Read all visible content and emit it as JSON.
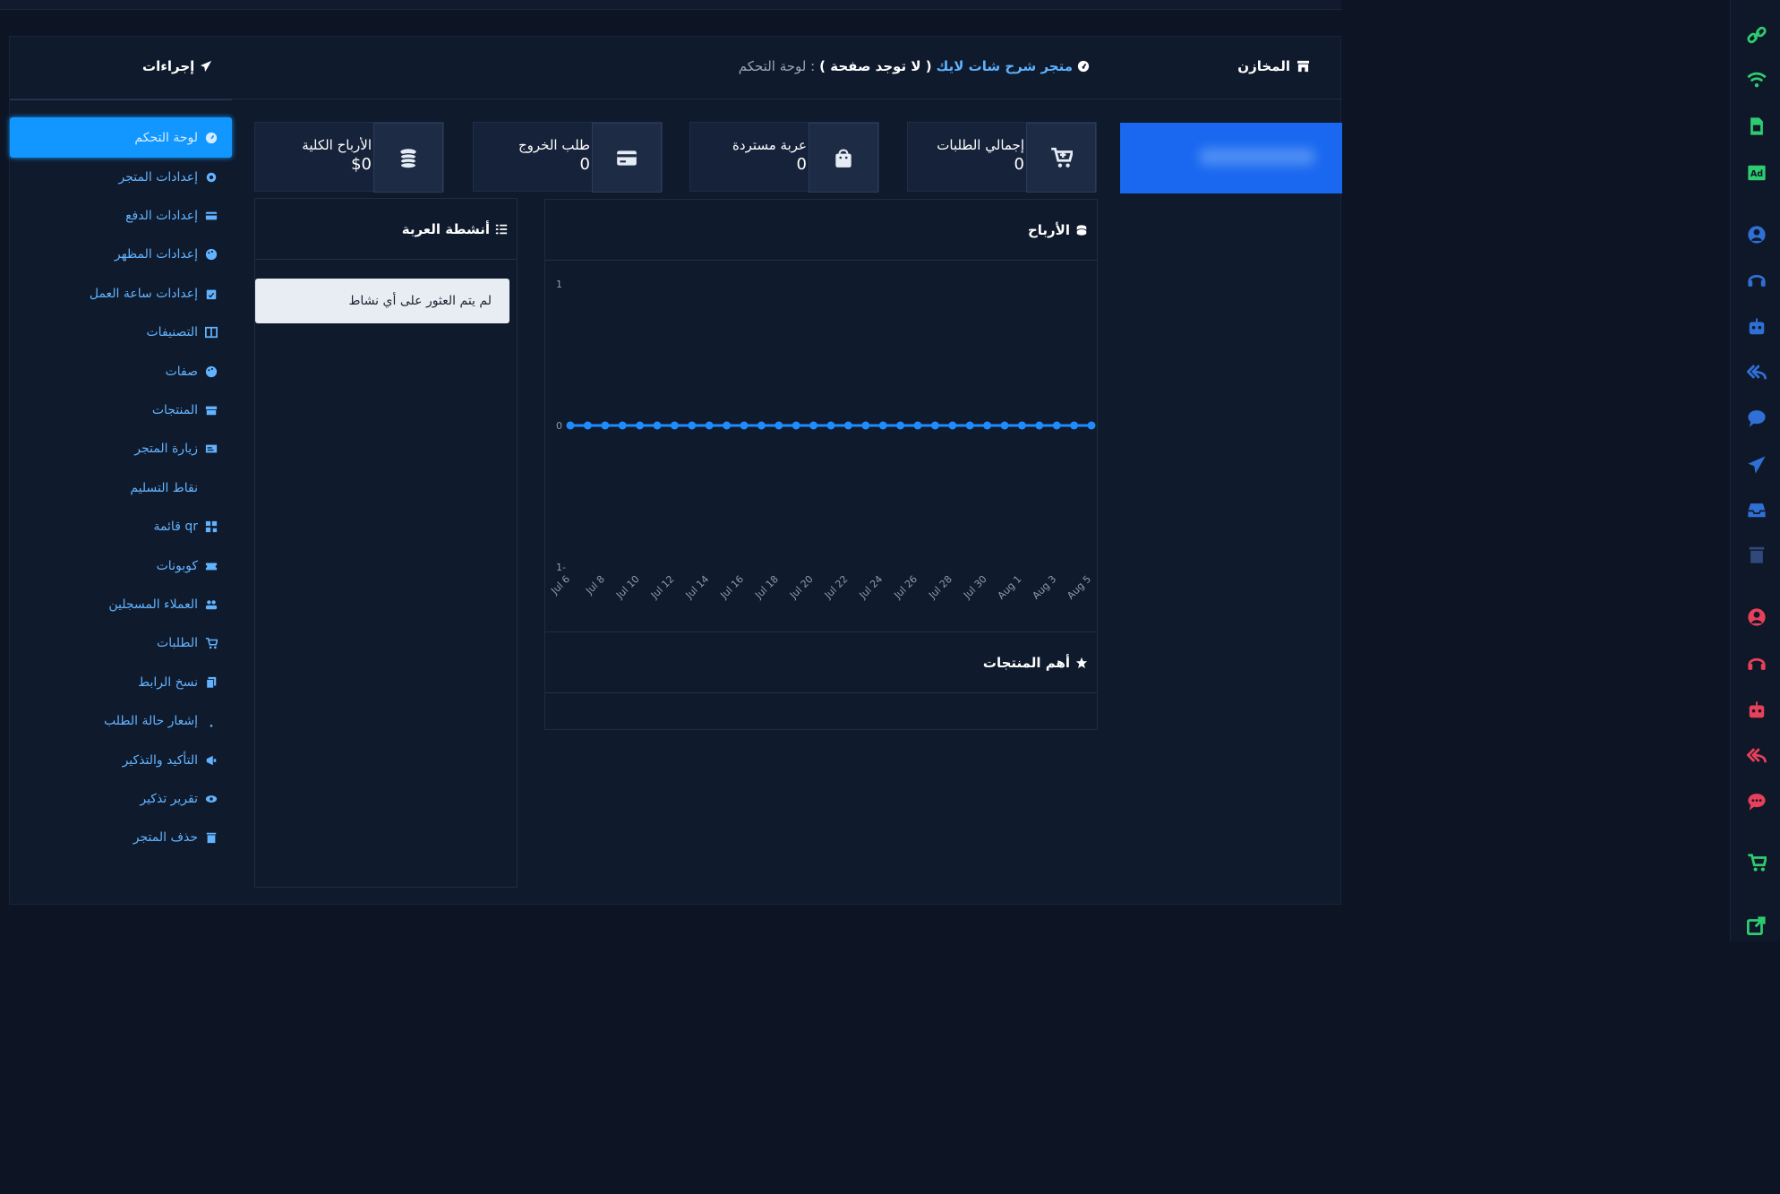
{
  "header": {
    "warehouses": "المخازن",
    "store_name": "متجر شرح شات لايك",
    "no_page": "( لا توجد صفحة )",
    "crumb": ": لوحة التحكم",
    "actions": "إجراءات"
  },
  "sidebar": {
    "items": [
      {
        "label": "لوحة التحكم",
        "icon": "gauge-icon",
        "active": true
      },
      {
        "label": "إعدادات المتجر",
        "icon": "gear-icon"
      },
      {
        "label": "إعدادات الدفع",
        "icon": "credit-card-icon"
      },
      {
        "label": "إعدادات المظهر",
        "icon": "palette-icon"
      },
      {
        "label": "إعدادات ساعة العمل",
        "icon": "calendar-check-icon"
      },
      {
        "label": "التصنيفات",
        "icon": "columns-icon"
      },
      {
        "label": "صفات",
        "icon": "palette-icon"
      },
      {
        "label": "المنتجات",
        "icon": "boxes-icon"
      },
      {
        "label": "زيارة المتجر",
        "icon": "store-card-icon"
      },
      {
        "label": "نقاط التسليم",
        "icon": "map-pin-icon"
      },
      {
        "label": "قائمة qr",
        "icon": "qrcode-icon"
      },
      {
        "label": "كوبونات",
        "icon": "coupon-icon"
      },
      {
        "label": "العملاء المسجلين",
        "icon": "users-icon"
      },
      {
        "label": "الطلبات",
        "icon": "cart-icon"
      },
      {
        "label": "نسخ الرابط",
        "icon": "copy-icon"
      },
      {
        "label": "إشعار حالة الطلب",
        "icon": "bell-icon"
      },
      {
        "label": "التأكيد والتذكير",
        "icon": "bullhorn-icon"
      },
      {
        "label": "تقرير تذكير",
        "icon": "eye-icon"
      },
      {
        "label": "حذف المتجر",
        "icon": "trash-icon"
      }
    ]
  },
  "cards": [
    {
      "label": "إجمالي الطلبات",
      "value": "0",
      "icon": "cart-plus-icon"
    },
    {
      "label": "عربة مستردة",
      "value": "0",
      "icon": "shopping-bag-icon"
    },
    {
      "label": "طلب الخروج",
      "value": "0",
      "icon": "credit-card-icon"
    },
    {
      "label": "الأرباح الكلية",
      "value": "$0",
      "icon": "coins-icon"
    }
  ],
  "profits": {
    "title": "الأرباح",
    "icon": "coins-icon"
  },
  "top_products": {
    "title": "أهم المنتجات",
    "icon": "star-icon"
  },
  "cart_activity": {
    "title": "أنشطة العربة",
    "icon": "list-icon",
    "empty_message": "لم يتم العثور على أي نشاط"
  },
  "chart_data": {
    "type": "line",
    "title": "",
    "x": [
      "Jul 6",
      "Jul 7",
      "Jul 8",
      "Jul 9",
      "Jul 10",
      "Jul 11",
      "Jul 12",
      "Jul 13",
      "Jul 14",
      "Jul 15",
      "Jul 16",
      "Jul 17",
      "Jul 18",
      "Jul 19",
      "Jul 20",
      "Jul 21",
      "Jul 22",
      "Jul 23",
      "Jul 24",
      "Jul 25",
      "Jul 26",
      "Jul 27",
      "Jul 28",
      "Jul 29",
      "Jul 30",
      "Jul 31",
      "Aug 1",
      "Aug 2",
      "Aug 3",
      "Aug 4",
      "Aug 5"
    ],
    "x_tick_labels": [
      "Jul 6",
      "Jul 8",
      "Jul 10",
      "Jul 12",
      "Jul 14",
      "Jul 16",
      "Jul 18",
      "Jul 20",
      "Jul 22",
      "Jul 24",
      "Jul 26",
      "Jul 28",
      "Jul 30",
      "Aug 1",
      "Aug 3",
      "Aug 5"
    ],
    "y_tick_labels": [
      "1",
      "0",
      "1-"
    ],
    "series": [
      {
        "values": [
          0,
          0,
          0,
          0,
          0,
          0,
          0,
          0,
          0,
          0,
          0,
          0,
          0,
          0,
          0,
          0,
          0,
          0,
          0,
          0,
          0,
          0,
          0,
          0,
          0,
          0,
          0,
          0,
          0,
          0,
          0
        ]
      }
    ],
    "ylim": [
      -1,
      1
    ],
    "grid": false,
    "line_color": "#1e8bff"
  },
  "colors": {
    "accent": "#1197ff",
    "link": "#62b3ff",
    "background": "#0d1525"
  },
  "rail_icons": [
    {
      "name": "link-icon",
      "color": "#2ecc71"
    },
    {
      "name": "wifi-icon",
      "color": "#2ecc71"
    },
    {
      "name": "sim-icon",
      "color": "#2ecc71"
    },
    {
      "name": "ad-icon",
      "color": "#2ecc71"
    },
    {
      "name": "user-circle-icon",
      "color": "#2f6fd6"
    },
    {
      "name": "headset-icon",
      "color": "#2f6fd6"
    },
    {
      "name": "robot-icon",
      "color": "#2f6fd6"
    },
    {
      "name": "reply-all-icon",
      "color": "#2f6fd6"
    },
    {
      "name": "comment-icon",
      "color": "#2f6fd6"
    },
    {
      "name": "paper-plane-icon",
      "color": "#2f6fd6"
    },
    {
      "name": "inbox-icon",
      "color": "#2f6fd6"
    },
    {
      "name": "trash-icon",
      "color": "#2f4a7a"
    },
    {
      "name": "user-circle-icon",
      "color": "#e8405a"
    },
    {
      "name": "headset-icon",
      "color": "#e8405a"
    },
    {
      "name": "robot-icon",
      "color": "#e8405a"
    },
    {
      "name": "reply-all-icon",
      "color": "#e8405a"
    },
    {
      "name": "comments-icon",
      "color": "#e8405a"
    },
    {
      "name": "cart-icon",
      "color": "#2ecc71"
    },
    {
      "name": "share-icon",
      "color": "#2ecc71"
    }
  ]
}
